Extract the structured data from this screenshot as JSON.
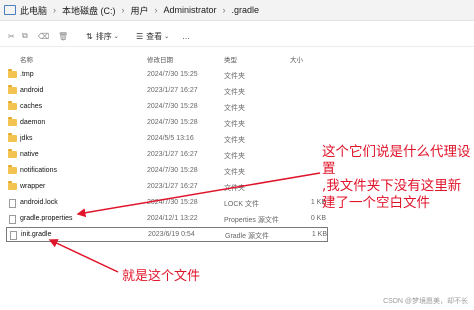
{
  "address_bar": {
    "crumbs": [
      "此电脑",
      "本地磁盘 (C:)",
      "用户",
      "Administrator",
      ".gradle"
    ]
  },
  "toolbar": {
    "sort_label": "排序",
    "view_label": "查看",
    "more": "…"
  },
  "columns": {
    "name": "名称",
    "date": "修改日期",
    "type": "类型",
    "size": "大小"
  },
  "files": [
    {
      "name": ".tmp",
      "date": "2024/7/30 15:25",
      "type": "文件夹",
      "size": "",
      "icon": "folder-icon"
    },
    {
      "name": "android",
      "date": "2023/1/27 16:27",
      "type": "文件夹",
      "size": "",
      "icon": "folder-icon"
    },
    {
      "name": "caches",
      "date": "2024/7/30 15:28",
      "type": "文件夹",
      "size": "",
      "icon": "folder-icon"
    },
    {
      "name": "daemon",
      "date": "2024/7/30 15:28",
      "type": "文件夹",
      "size": "",
      "icon": "folder-icon"
    },
    {
      "name": "jdks",
      "date": "2024/5/5 13:16",
      "type": "文件夹",
      "size": "",
      "icon": "folder-icon"
    },
    {
      "name": "native",
      "date": "2023/1/27 16:27",
      "type": "文件夹",
      "size": "",
      "icon": "folder-icon"
    },
    {
      "name": "notifications",
      "date": "2024/7/30 15:28",
      "type": "文件夹",
      "size": "",
      "icon": "folder-icon"
    },
    {
      "name": "wrapper",
      "date": "2023/1/27 16:27",
      "type": "文件夹",
      "size": "",
      "icon": "folder-icon"
    },
    {
      "name": "android.lock",
      "date": "2024/7/30 15:28",
      "type": "LOCK 文件",
      "size": "1 KB",
      "icon": "file-icon"
    },
    {
      "name": "gradle.properties",
      "date": "2024/12/1 13:22",
      "type": "Properties 源文件",
      "size": "0 KB",
      "icon": "file-icon"
    },
    {
      "name": "init.gradle",
      "date": "2023/6/19 0:54",
      "type": "Gradle 源文件",
      "size": "1 KB",
      "icon": "file-icon"
    }
  ],
  "annotations": {
    "top_line1": "这个它们说是什么代理设置",
    "top_line2": ",我文件夹下没有这里新",
    "top_line3": "建了一个空白文件",
    "bottom": "就是这个文件",
    "arrow_color": "#e0142a"
  },
  "watermark": "CSDN @梦境愿美，却不长"
}
